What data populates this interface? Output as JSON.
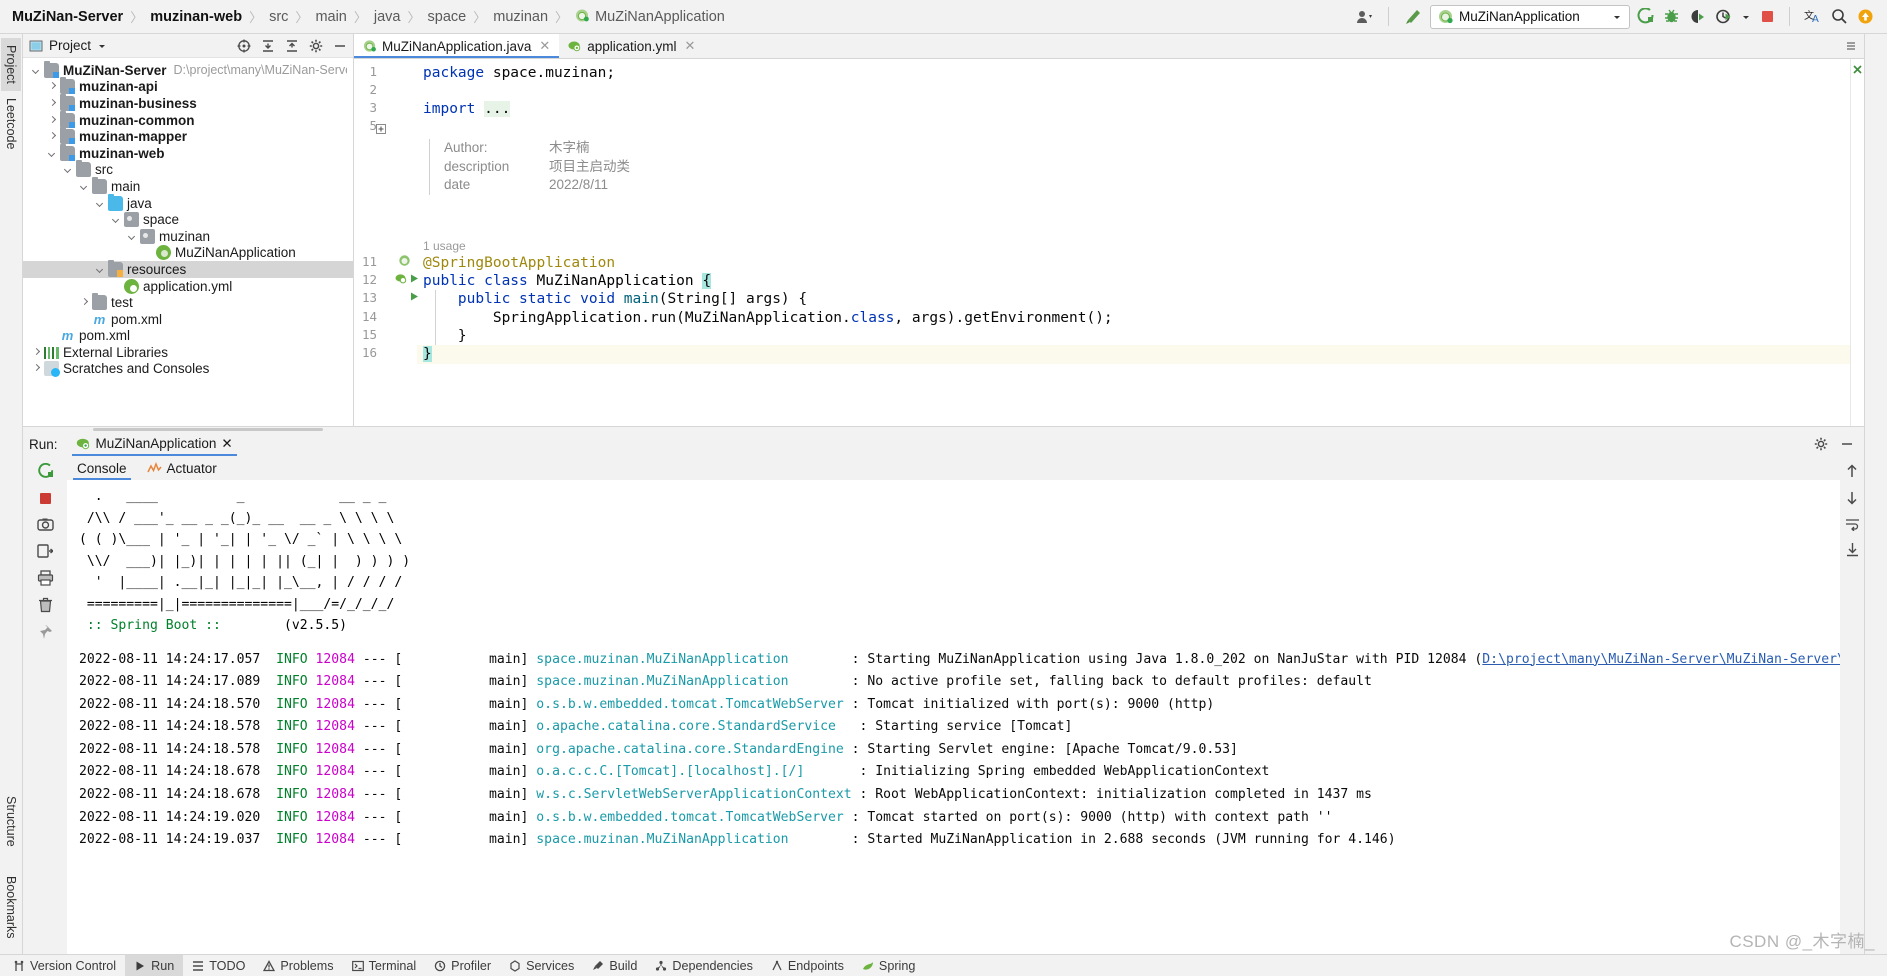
{
  "breadcrumb": {
    "items": [
      {
        "label": "MuZiNan-Server",
        "bold": true
      },
      {
        "label": "muzinan-web",
        "bold": true
      },
      {
        "label": "src",
        "bold": false
      },
      {
        "label": "main",
        "bold": false
      },
      {
        "label": "java",
        "bold": false
      },
      {
        "label": "space",
        "bold": false
      },
      {
        "label": "muzinan",
        "bold": false
      },
      {
        "label": "MuZiNanApplication",
        "bold": false,
        "icon": "spring-class-icon"
      }
    ],
    "separator": "〉"
  },
  "toolbar": {
    "account_icon": "user-account-icon",
    "hammer_icon": "build-hammer-icon",
    "run_config": "MuZiNanApplication",
    "run_config_icon": "spring-boot-icon",
    "dropdown_icon": "chevron-down-icon",
    "buttons": [
      {
        "name": "run-button",
        "icon": "run-arrow-icon",
        "color": "#4a9e4a"
      },
      {
        "name": "debug-button",
        "icon": "debug-bug-icon",
        "color": "#4a9e4a"
      },
      {
        "name": "run-with-coverage-button",
        "icon": "coverage-icon",
        "color": "#3c3c3c"
      },
      {
        "name": "profiler-button",
        "icon": "profiler-icon",
        "color": "#3c3c3c"
      },
      {
        "name": "stop-button",
        "icon": "stop-square-icon",
        "color": "#e05047"
      },
      {
        "name": "translate-button",
        "icon": "translate-icon",
        "color": "#2a6bbd"
      },
      {
        "name": "search-everywhere-button",
        "icon": "search-icon",
        "color": "#3c3c3c"
      },
      {
        "name": "update-button",
        "icon": "update-arrow-icon",
        "color": "#f0a30a"
      }
    ]
  },
  "left_rail": {
    "tabs": [
      {
        "label": "Project",
        "selected": true
      },
      {
        "label": "Leetcode",
        "selected": false
      }
    ],
    "bottom_tabs": [
      {
        "label": "Structure"
      },
      {
        "label": "Bookmarks"
      }
    ]
  },
  "project_panel": {
    "title": "Project",
    "title_icon": "project-view-icon",
    "dropdown_icon": "chevron-down-icon",
    "actions": [
      {
        "name": "select-opened-file-icon"
      },
      {
        "name": "expand-all-icon"
      },
      {
        "name": "collapse-all-icon"
      },
      {
        "name": "settings-gear-icon"
      },
      {
        "name": "hide-panel-icon"
      }
    ],
    "tree": [
      {
        "indent": 0,
        "arrow": "down",
        "icon": "module-icon",
        "label": "MuZiNan-Server",
        "bold": true,
        "path": "D:\\project\\many\\MuZiNan-Server\\MuZiN"
      },
      {
        "indent": 1,
        "arrow": "right",
        "icon": "module-icon",
        "label": "muzinan-api",
        "bold": true
      },
      {
        "indent": 1,
        "arrow": "right",
        "icon": "module-icon",
        "label": "muzinan-business",
        "bold": true
      },
      {
        "indent": 1,
        "arrow": "right",
        "icon": "module-icon",
        "label": "muzinan-common",
        "bold": true
      },
      {
        "indent": 1,
        "arrow": "right",
        "icon": "module-icon",
        "label": "muzinan-mapper",
        "bold": true
      },
      {
        "indent": 1,
        "arrow": "down",
        "icon": "module-icon",
        "label": "muzinan-web",
        "bold": true
      },
      {
        "indent": 2,
        "arrow": "down",
        "icon": "folder-icon",
        "label": "src",
        "bold": false
      },
      {
        "indent": 3,
        "arrow": "down",
        "icon": "folder-icon",
        "label": "main",
        "bold": false
      },
      {
        "indent": 4,
        "arrow": "down",
        "icon": "source-folder-icon",
        "label": "java",
        "bold": false
      },
      {
        "indent": 5,
        "arrow": "down",
        "icon": "package-icon",
        "label": "space",
        "bold": false
      },
      {
        "indent": 6,
        "arrow": "down",
        "icon": "package-icon",
        "label": "muzinan",
        "bold": false
      },
      {
        "indent": 7,
        "arrow": "none",
        "icon": "spring-class-icon",
        "label": "MuZiNanApplication",
        "bold": false
      },
      {
        "indent": 4,
        "arrow": "down",
        "icon": "resources-icon",
        "label": "resources",
        "bold": false,
        "selected": true
      },
      {
        "indent": 5,
        "arrow": "none",
        "icon": "yaml-spring-icon",
        "label": "application.yml",
        "bold": false
      },
      {
        "indent": 3,
        "arrow": "right",
        "icon": "folder-icon",
        "label": "test",
        "bold": false
      },
      {
        "indent": 3,
        "arrow": "none",
        "icon": "maven-icon",
        "label": "pom.xml",
        "bold": false
      },
      {
        "indent": 1,
        "arrow": "none",
        "icon": "maven-icon",
        "label": "pom.xml",
        "bold": false
      },
      {
        "indent": 0,
        "arrow": "right",
        "icon": "library-icon",
        "label": "External Libraries",
        "bold": false
      },
      {
        "indent": 0,
        "arrow": "right",
        "icon": "scratches-icon",
        "label": "Scratches and Consoles",
        "bold": false
      }
    ]
  },
  "editor": {
    "tabs": [
      {
        "label": "MuZiNanApplication.java",
        "icon": "spring-class-icon",
        "active": true,
        "close_icon": "close-icon"
      },
      {
        "label": "application.yml",
        "icon": "yaml-spring-icon",
        "active": false,
        "close_icon": "close-icon"
      }
    ],
    "gutter_lines": [
      "1",
      "2",
      "3",
      "5",
      "11",
      "12",
      "13",
      "14",
      "15",
      "16"
    ],
    "code": {
      "line1_kw": "package",
      "line1_rest": " space.muzinan;",
      "line3_kw": "import",
      "line3_fold": "...",
      "doc": [
        {
          "key": "Author:",
          "value": "木字楠"
        },
        {
          "key": "description",
          "value": "项目主启动类"
        },
        {
          "key": "date",
          "value": "2022/8/11"
        }
      ],
      "usage_hint": "1 usage",
      "annotation": "@SpringBootApplication",
      "l12_a": "public class ",
      "l12_b": "MuZiNanApplication ",
      "l12_brace": "{",
      "l13_a": "    public static void ",
      "l13_b": "main",
      "l13_c": "(String[] args) {",
      "l14": "        SpringApplication.run(MuZiNanApplication.",
      "l14_kw": "class",
      "l14_rest": ", args).getEnvironment();",
      "l15": "    }",
      "l16": "}"
    }
  },
  "run_panel": {
    "label": "Run:",
    "tab_label": "MuZiNanApplication",
    "tab_icon": "spring-boot-icon",
    "tab_close_icon": "close-icon",
    "settings_icon": "settings-gear-icon",
    "minimize_icon": "minimize-icon",
    "console_tabs": [
      {
        "label": "Console",
        "icon": "console-icon",
        "selected": true
      },
      {
        "label": "Actuator",
        "icon": "actuator-icon",
        "selected": false
      }
    ],
    "rail_buttons": [
      {
        "name": "rerun-button",
        "icon": "rerun-icon"
      },
      {
        "name": "stop-button",
        "icon": "stop-square-icon"
      },
      {
        "name": "screenshot-button",
        "icon": "camera-icon"
      },
      {
        "name": "export-button",
        "icon": "export-icon"
      },
      {
        "name": "print-button",
        "icon": "print-icon"
      },
      {
        "name": "clear-all-button",
        "icon": "trash-icon"
      },
      {
        "name": "pin-button",
        "icon": "pin-icon"
      }
    ],
    "rail2_buttons": [
      {
        "name": "scroll-up-button",
        "icon": "arrow-up-icon"
      },
      {
        "name": "scroll-down-button",
        "icon": "arrow-down-icon"
      },
      {
        "name": "soft-wrap-button",
        "icon": "wrap-icon"
      },
      {
        "name": "scroll-to-end-button",
        "icon": "scroll-end-icon"
      }
    ],
    "banner": {
      "lines": [
        "  .   ____          _            __ _ _",
        " /\\\\ / ___'_ __ _ _(_)_ __  __ _ \\ \\ \\ \\",
        "( ( )\\___ | '_ | '_| | '_ \\/ _` | \\ \\ \\ \\",
        " \\\\/  ___)| |_)| | | | | || (_| |  ) ) ) )",
        "  '  |____| .__|_| |_|_| |_\\__, | / / / /",
        " =========|_|==============|___/=/_/_/_/"
      ],
      "footer_left": " :: Spring Boot :: ",
      "footer_right": "       (v2.5.5)"
    },
    "log": [
      {
        "ts": "2022-08-11 14:24:17.057",
        "level": "INFO",
        "pid": "12084",
        "sep": " --- [",
        "thread": "           main]",
        "logger": "space.muzinan.MuZiNanApplication",
        "pad": "       ",
        "msg": ": Starting MuZiNanApplication using Java 1.8.0_202 on NanJuStar with PID 12084 (",
        "link": "D:\\project\\many\\MuZiNan-Server\\MuZiNan-Server\\"
      },
      {
        "ts": "2022-08-11 14:24:17.089",
        "level": "INFO",
        "pid": "12084",
        "sep": " --- [",
        "thread": "           main]",
        "logger": "space.muzinan.MuZiNanApplication",
        "pad": "       ",
        "msg": ": No active profile set, falling back to default profiles: default",
        "link": ""
      },
      {
        "ts": "2022-08-11 14:24:18.570",
        "level": "INFO",
        "pid": "12084",
        "sep": " --- [",
        "thread": "           main]",
        "logger": "o.s.b.w.embedded.tomcat.TomcatWebServer",
        "pad": "",
        "msg": ": Tomcat initialized with port(s): 9000 (http)",
        "link": ""
      },
      {
        "ts": "2022-08-11 14:24:18.578",
        "level": "INFO",
        "pid": "12084",
        "sep": " --- [",
        "thread": "           main]",
        "logger": "o.apache.catalina.core.StandardService",
        "pad": "  ",
        "msg": ": Starting service [Tomcat]",
        "link": ""
      },
      {
        "ts": "2022-08-11 14:24:18.578",
        "level": "INFO",
        "pid": "12084",
        "sep": " --- [",
        "thread": "           main]",
        "logger": "org.apache.catalina.core.StandardEngine",
        "pad": "",
        "msg": ": Starting Servlet engine: [Apache Tomcat/9.0.53]",
        "link": ""
      },
      {
        "ts": "2022-08-11 14:24:18.678",
        "level": "INFO",
        "pid": "12084",
        "sep": " --- [",
        "thread": "           main]",
        "logger": "o.a.c.c.C.[Tomcat].[localhost].[/]",
        "pad": "      ",
        "msg": ": Initializing Spring embedded WebApplicationContext",
        "link": ""
      },
      {
        "ts": "2022-08-11 14:24:18.678",
        "level": "INFO",
        "pid": "12084",
        "sep": " --- [",
        "thread": "           main]",
        "logger": "w.s.c.ServletWebServerApplicationContext",
        "pad": "",
        "msg": ": Root WebApplicationContext: initialization completed in 1437 ms",
        "link": ""
      },
      {
        "ts": "2022-08-11 14:24:19.020",
        "level": "INFO",
        "pid": "12084",
        "sep": " --- [",
        "thread": "           main]",
        "logger": "o.s.b.w.embedded.tomcat.TomcatWebServer",
        "pad": "",
        "msg": ": Tomcat started on port(s): 9000 (http) with context path ''",
        "link": ""
      },
      {
        "ts": "2022-08-11 14:24:19.037",
        "level": "INFO",
        "pid": "12084",
        "sep": " --- [",
        "thread": "           main]",
        "logger": "space.muzinan.MuZiNanApplication",
        "pad": "       ",
        "msg": ": Started MuZiNanApplication in 2.688 seconds (JVM running for 4.146)",
        "link": ""
      }
    ]
  },
  "status_bar": {
    "items": [
      {
        "label": "Version Control",
        "icon": "version-control-icon",
        "selected": false
      },
      {
        "label": "Run",
        "icon": "run-arrow-icon",
        "selected": true
      },
      {
        "label": "TODO",
        "icon": "todo-icon",
        "selected": false
      },
      {
        "label": "Problems",
        "icon": "problems-icon",
        "selected": false
      },
      {
        "label": "Terminal",
        "icon": "terminal-icon",
        "selected": false
      },
      {
        "label": "Profiler",
        "icon": "profiler-icon",
        "selected": false
      },
      {
        "label": "Services",
        "icon": "services-icon",
        "selected": false
      },
      {
        "label": "Build",
        "icon": "build-hammer-icon",
        "selected": false
      },
      {
        "label": "Dependencies",
        "icon": "dependencies-icon",
        "selected": false
      },
      {
        "label": "Endpoints",
        "icon": "endpoints-icon",
        "selected": false
      },
      {
        "label": "Spring",
        "icon": "spring-leaf-icon",
        "selected": false
      }
    ]
  },
  "watermark": "CSDN @_木字楠_",
  "colors": {
    "accent": "#4a89dc",
    "spring_green": "#6db33f",
    "log_info": "#00802b",
    "log_pid": "#cc00cc",
    "log_logger": "#1a9aa8",
    "link": "#2a5db0",
    "selection": "#d5d5d5"
  }
}
